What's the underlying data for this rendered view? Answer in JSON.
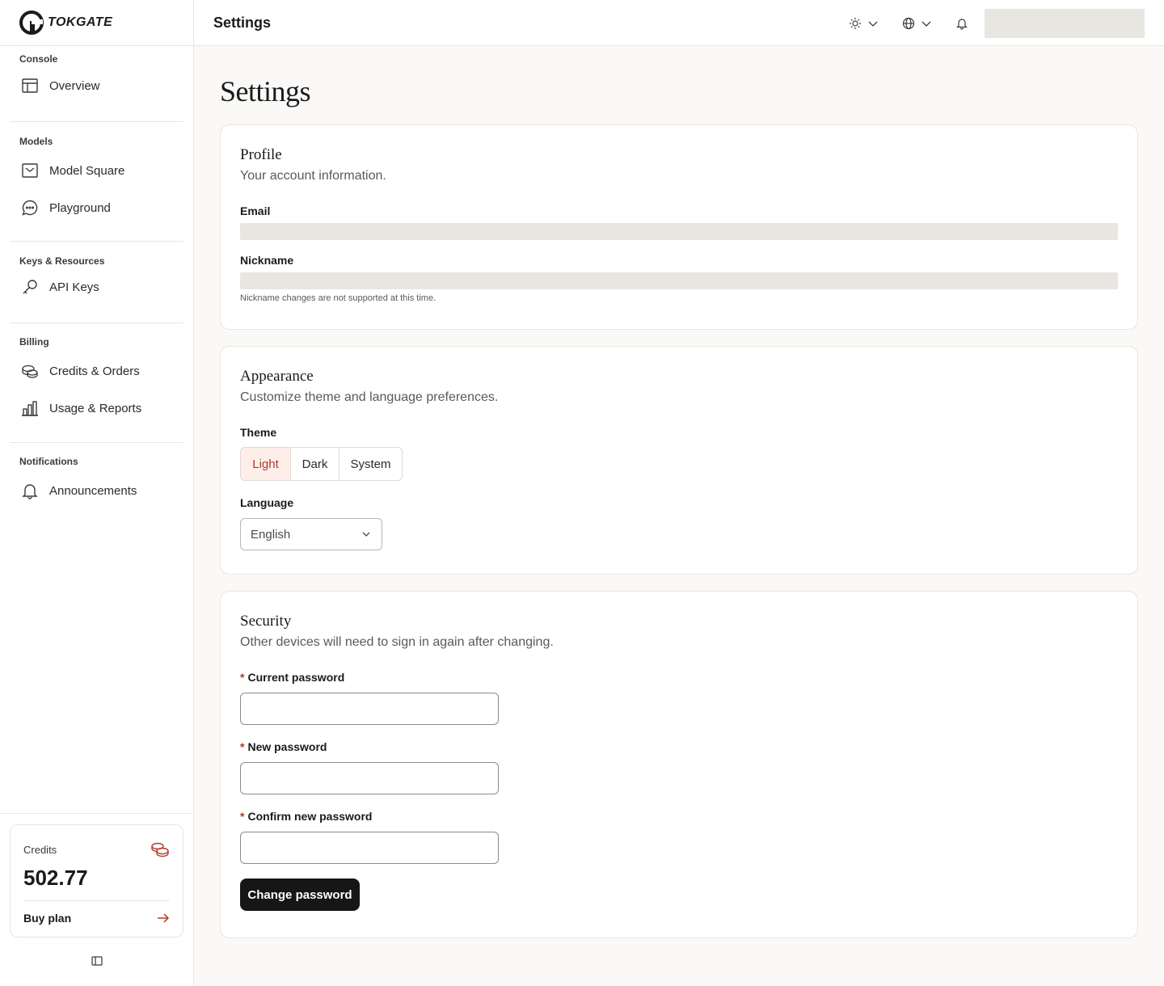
{
  "brand": {
    "name": "TOKGATE"
  },
  "topbar": {
    "title": "Settings"
  },
  "sidebar": {
    "sections": [
      {
        "label": "Console",
        "items": [
          {
            "label": "Overview",
            "icon": "layout-icon"
          }
        ]
      },
      {
        "label": "Models",
        "items": [
          {
            "label": "Model Square",
            "icon": "inbox-icon"
          },
          {
            "label": "Playground",
            "icon": "chat-icon"
          }
        ]
      },
      {
        "label": "Keys & Resources",
        "items": [
          {
            "label": "API Keys",
            "icon": "key-icon"
          }
        ]
      },
      {
        "label": "Billing",
        "items": [
          {
            "label": "Credits & Orders",
            "icon": "coins-icon"
          },
          {
            "label": "Usage & Reports",
            "icon": "bar-chart-icon"
          }
        ]
      },
      {
        "label": "Notifications",
        "items": [
          {
            "label": "Announcements",
            "icon": "bell-icon"
          }
        ]
      }
    ],
    "credits": {
      "label": "Credits",
      "value": "502.77",
      "buy_label": "Buy plan"
    }
  },
  "page": {
    "title": "Settings"
  },
  "profile": {
    "title": "Profile",
    "subtitle": "Your account information.",
    "email_label": "Email",
    "nickname_label": "Nickname",
    "nickname_hint": "Nickname changes are not supported at this time."
  },
  "appearance": {
    "title": "Appearance",
    "subtitle": "Customize theme and language preferences.",
    "theme_label": "Theme",
    "theme_options": [
      "Light",
      "Dark",
      "System"
    ],
    "theme_selected": "Light",
    "language_label": "Language",
    "language_value": "English"
  },
  "security": {
    "title": "Security",
    "subtitle": "Other devices will need to sign in again after changing.",
    "current_label": "Current password",
    "new_label": "New password",
    "confirm_label": "Confirm new password",
    "required_mark": "*",
    "submit_label": "Change password"
  },
  "colors": {
    "accent": "#b23a2b",
    "accent_bg": "#fdeeea",
    "primary_button": "#161616",
    "page_bg": "#faf9f7"
  }
}
